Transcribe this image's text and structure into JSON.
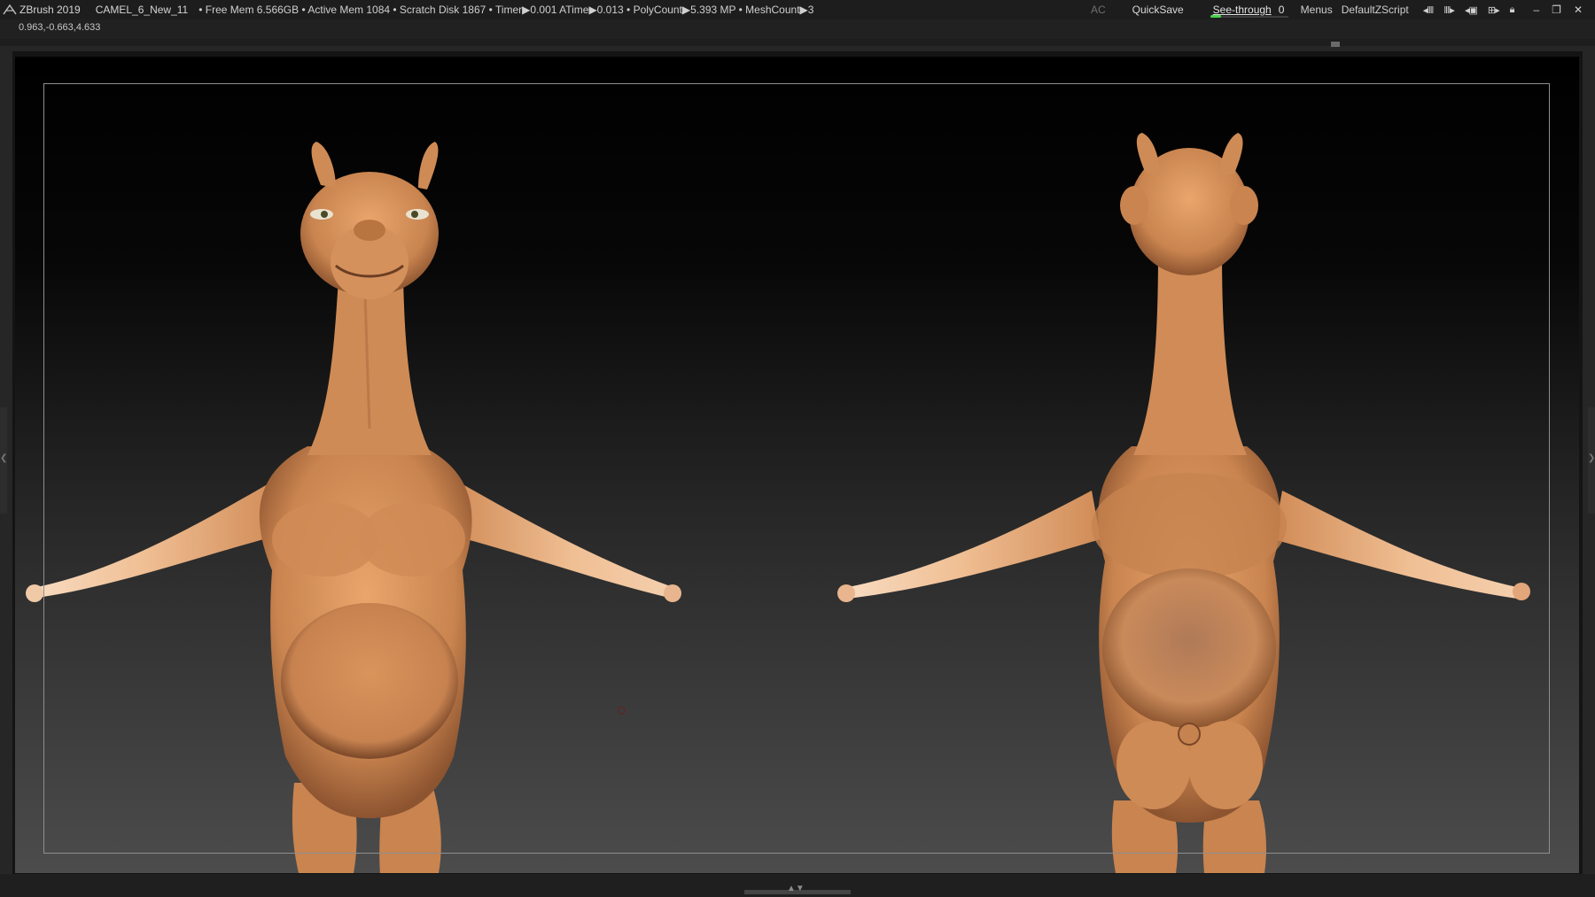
{
  "topbar": {
    "app_title": "ZBrush 2019",
    "document_name": "CAMEL_6_New_11",
    "stats": "• Free Mem 6.566GB • Active Mem 1084 • Scratch Disk 1867 • Timer▶0.001 ATime▶0.013 • PolyCount▶5.393 MP • MeshCount▶3",
    "ac_label": "AC",
    "quicksave_label": "QuickSave",
    "see_through": {
      "label": "See-through",
      "value": "0",
      "level": 0
    },
    "menus_label": "Menus",
    "script_label": "DefaultZScript"
  },
  "coordinates": "0.963,-0.663,4.633",
  "icons": {
    "logo": "zbrush-logo-icon",
    "ui_icons": [
      "interface-icon",
      "palette-icon",
      "toggle-icon",
      "layout-icon",
      "lock-icon"
    ],
    "window_controls": [
      "minimize-icon",
      "restore-icon",
      "close-icon"
    ]
  },
  "colors": {
    "accent_green": "#47d147",
    "skin": "#d9925c",
    "canvas_top": "#000000",
    "canvas_bottom": "#4c4c4c"
  }
}
